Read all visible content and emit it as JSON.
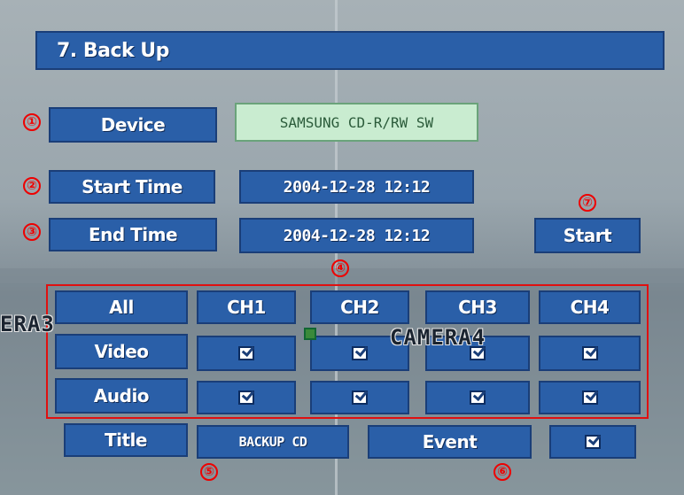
{
  "header": {
    "top_strip": "",
    "title": "7. Back Up"
  },
  "labels": {
    "device": "Device",
    "start_time": "Start Time",
    "end_time": "End Time",
    "all": "All",
    "video": "Video",
    "audio": "Audio",
    "title": "Title",
    "event": "Event"
  },
  "values": {
    "device": "SAMSUNG CD-R/RW SW",
    "start_time": "2004-12-28 12:12",
    "end_time": "2004-12-28 12:12",
    "title_value": "BACKUP CD"
  },
  "buttons": {
    "start": "Start"
  },
  "channels": [
    "CH1",
    "CH2",
    "CH3",
    "CH4"
  ],
  "overlays": {
    "camera_left": "ERA3",
    "camera_right": "CAMERA4"
  },
  "markers": [
    "①",
    "②",
    "③",
    "④",
    "⑤",
    "⑥",
    "⑦"
  ],
  "colors": {
    "panel": "#2a5fa8",
    "device_field": "#c9ecd0",
    "annotation": "#e00000"
  }
}
